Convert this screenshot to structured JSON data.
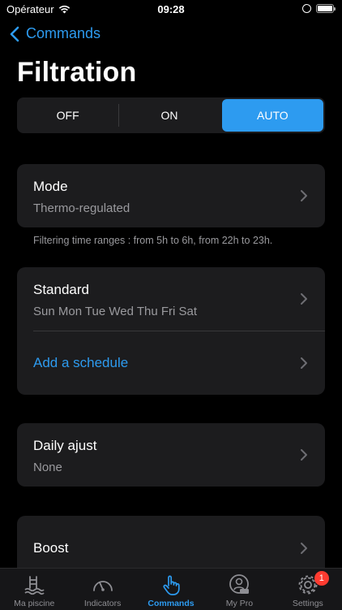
{
  "status_bar": {
    "carrier": "Opérateur",
    "time": "09:28"
  },
  "nav": {
    "back_label": "Commands"
  },
  "page": {
    "title": "Filtration"
  },
  "segmented": {
    "options": [
      "OFF",
      "ON",
      "AUTO"
    ],
    "selected": "AUTO"
  },
  "mode": {
    "title": "Mode",
    "value": "Thermo-regulated"
  },
  "note": "Filtering time ranges : from 5h to 6h, from 22h to 23h.",
  "schedule": {
    "title": "Standard",
    "days": "Sun Mon Tue Wed Thu Fri Sat",
    "add_label": "Add a schedule"
  },
  "daily": {
    "title": "Daily ajust",
    "value": "None"
  },
  "boost": {
    "title": "Boost"
  },
  "tabs": [
    {
      "label": "Ma piscine",
      "icon": "pool-icon"
    },
    {
      "label": "Indicators",
      "icon": "gauge-icon"
    },
    {
      "label": "Commands",
      "icon": "hand-pointer-icon"
    },
    {
      "label": "My Pro",
      "icon": "pro-badge-icon"
    },
    {
      "label": "Settings",
      "icon": "gear-icon",
      "badge": "1"
    }
  ],
  "colors": {
    "accent": "#2d9bf0",
    "card": "#1c1c1e",
    "badge": "#ff3b30"
  }
}
